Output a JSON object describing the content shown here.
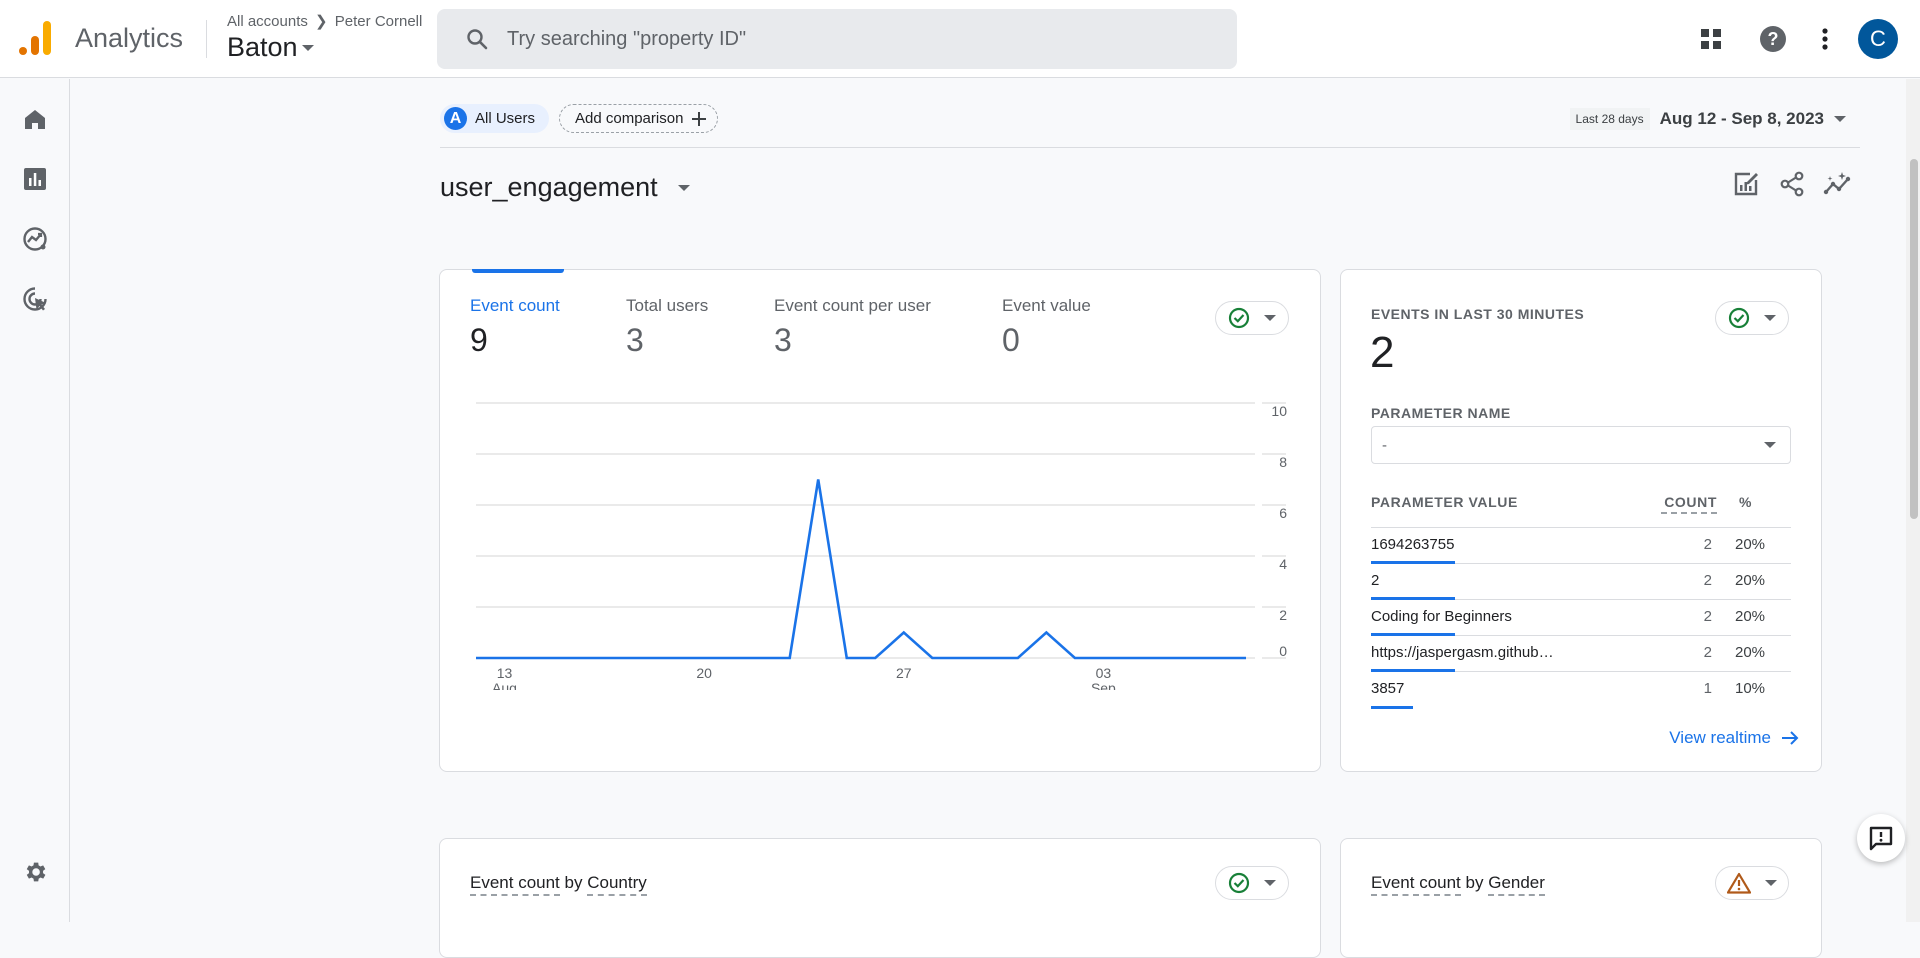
{
  "topbar": {
    "app_name": "Analytics",
    "breadcrumb": {
      "root": "All accounts",
      "separator": ">",
      "account": "Peter Cornell"
    },
    "property": "Baton",
    "search_placeholder": "Try searching \"property ID\"",
    "avatar_letter": "C",
    "icons": [
      "apps-grid-icon",
      "help-icon",
      "more-vert-icon"
    ]
  },
  "sidenav": {
    "items": [
      {
        "name": "home",
        "icon": "home-icon"
      },
      {
        "name": "reports",
        "icon": "bar-chart-icon"
      },
      {
        "name": "explore",
        "icon": "explore-trend-icon"
      },
      {
        "name": "advertising",
        "icon": "target-cursor-icon"
      }
    ],
    "settings_icon": "gear-icon"
  },
  "segments": {
    "active_badge": "A",
    "active_label": "All Users",
    "add_label": "Add comparison"
  },
  "date_range": {
    "preset": "Last 28 days",
    "range": "Aug 12 - Sep 8, 2023"
  },
  "page_title": "user_engagement",
  "title_actions": [
    "customize-report-icon",
    "share-icon",
    "insights-icon"
  ],
  "main_card": {
    "metrics": [
      {
        "label": "Event count",
        "value": "9",
        "active": true
      },
      {
        "label": "Total users",
        "value": "3",
        "active": false
      },
      {
        "label": "Event count per user",
        "value": "3",
        "active": false
      },
      {
        "label": "Event value",
        "value": "0",
        "active": false
      }
    ],
    "status": "check-circle-icon"
  },
  "chart_data": {
    "type": "line",
    "title": "",
    "xlabel": "",
    "ylabel": "Event count",
    "x": [
      "Aug 12",
      "Aug 13",
      "Aug 14",
      "Aug 15",
      "Aug 16",
      "Aug 17",
      "Aug 18",
      "Aug 19",
      "Aug 20",
      "Aug 21",
      "Aug 22",
      "Aug 23",
      "Aug 24",
      "Aug 25",
      "Aug 26",
      "Aug 27",
      "Aug 28",
      "Aug 29",
      "Aug 30",
      "Aug 31",
      "Sep 1",
      "Sep 2",
      "Sep 3",
      "Sep 4",
      "Sep 5",
      "Sep 6",
      "Sep 7",
      "Sep 8"
    ],
    "series": [
      {
        "name": "Event count",
        "color": "#1a73e8",
        "values": [
          0,
          0,
          0,
          0,
          0,
          0,
          0,
          0,
          0,
          0,
          0,
          0,
          7,
          0,
          0,
          1,
          0,
          0,
          0,
          0,
          1,
          0,
          0,
          0,
          0,
          0,
          0,
          0
        ]
      }
    ],
    "ylim": [
      0,
      10
    ],
    "yticks": [
      0,
      2,
      4,
      6,
      8,
      10
    ],
    "xticks": [
      {
        "index": 1,
        "label": "13",
        "sublabel": "Aug"
      },
      {
        "index": 8,
        "label": "20",
        "sublabel": ""
      },
      {
        "index": 15,
        "label": "27",
        "sublabel": ""
      },
      {
        "index": 22,
        "label": "03",
        "sublabel": "Sep"
      }
    ],
    "grid": true,
    "y_axis_side": "right"
  },
  "realtime_card": {
    "title": "EVENTS IN LAST 30 MINUTES",
    "value": "2",
    "status": "check-circle-icon",
    "param_name_label": "PARAMETER NAME",
    "param_name_value": "-",
    "columns": [
      "PARAMETER VALUE",
      "COUNT",
      "%"
    ],
    "rows": [
      {
        "value": "1694263755",
        "count": "2",
        "percent": "20%",
        "share": 0.2
      },
      {
        "value": "2",
        "count": "2",
        "percent": "20%",
        "share": 0.2
      },
      {
        "value": "Coding for Beginners",
        "count": "2",
        "percent": "20%",
        "share": 0.2
      },
      {
        "value": "https://jaspergasm.github…",
        "count": "2",
        "percent": "20%",
        "share": 0.2
      },
      {
        "value": "3857",
        "count": "1",
        "percent": "10%",
        "share": 0.1
      }
    ],
    "view_link": "View realtime"
  },
  "country_card": {
    "title_metric": "Event count",
    "title_by": "by",
    "title_dim": "Country",
    "status": "check-circle-icon"
  },
  "gender_card": {
    "title_metric": "Event count",
    "title_by": "by",
    "title_dim": "Gender",
    "status": "warning-icon"
  },
  "colors": {
    "accent": "#1a73e8",
    "success": "#188038",
    "warning": "#b05a1a",
    "avatar": "#01579b"
  }
}
